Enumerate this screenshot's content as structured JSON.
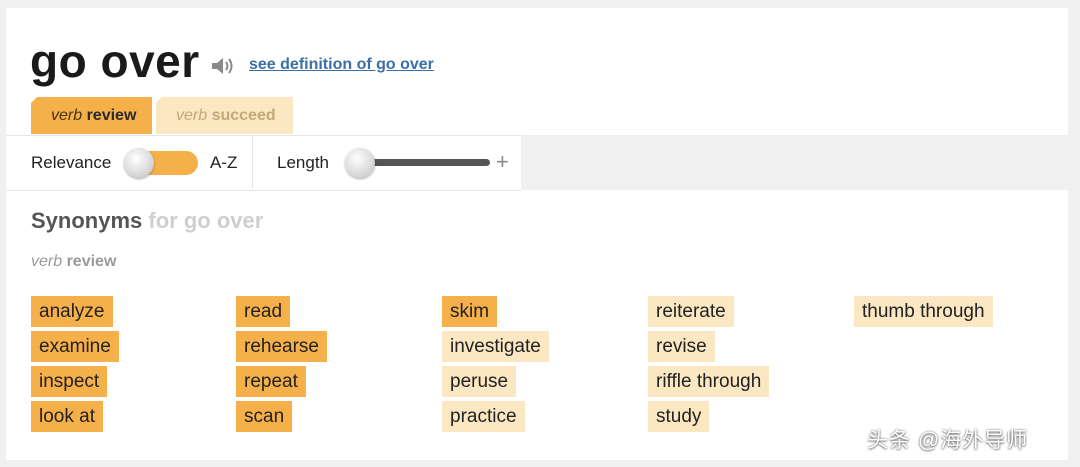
{
  "header": {
    "word": "go over",
    "speaker_icon": "speaker-icon",
    "definition_link": "see definition of go over"
  },
  "tabs": [
    {
      "pos": "verb",
      "word": "review",
      "active": true
    },
    {
      "pos": "verb",
      "word": "succeed",
      "active": false
    }
  ],
  "filters": {
    "relevance_label": "Relevance",
    "az_label": "A-Z",
    "length_label": "Length",
    "plus_label": "+"
  },
  "synonyms": {
    "heading": "Synonyms",
    "heading_sub": "for go over",
    "sense_pos": "verb",
    "sense_word": "review",
    "columns": [
      [
        {
          "word": "analyze",
          "relevance": 3
        },
        {
          "word": "examine",
          "relevance": 3
        },
        {
          "word": "inspect",
          "relevance": 3
        },
        {
          "word": "look at",
          "relevance": 3
        }
      ],
      [
        {
          "word": "read",
          "relevance": 3
        },
        {
          "word": "rehearse",
          "relevance": 3
        },
        {
          "word": "repeat",
          "relevance": 3
        },
        {
          "word": "scan",
          "relevance": 3
        }
      ],
      [
        {
          "word": "skim",
          "relevance": 3
        },
        {
          "word": "investigate",
          "relevance": 2
        },
        {
          "word": "peruse",
          "relevance": 2
        },
        {
          "word": "practice",
          "relevance": 2
        }
      ],
      [
        {
          "word": "reiterate",
          "relevance": 2
        },
        {
          "word": "revise",
          "relevance": 2
        },
        {
          "word": "riffle through",
          "relevance": 2
        },
        {
          "word": "study",
          "relevance": 2
        }
      ],
      [
        {
          "word": "thumb through",
          "relevance": 2
        }
      ]
    ]
  },
  "watermark": "头条 @海外导师",
  "colors": {
    "relevance_high": "#f5b04a",
    "relevance_medium": "#fbe7c2",
    "link": "#3b6fa6"
  }
}
